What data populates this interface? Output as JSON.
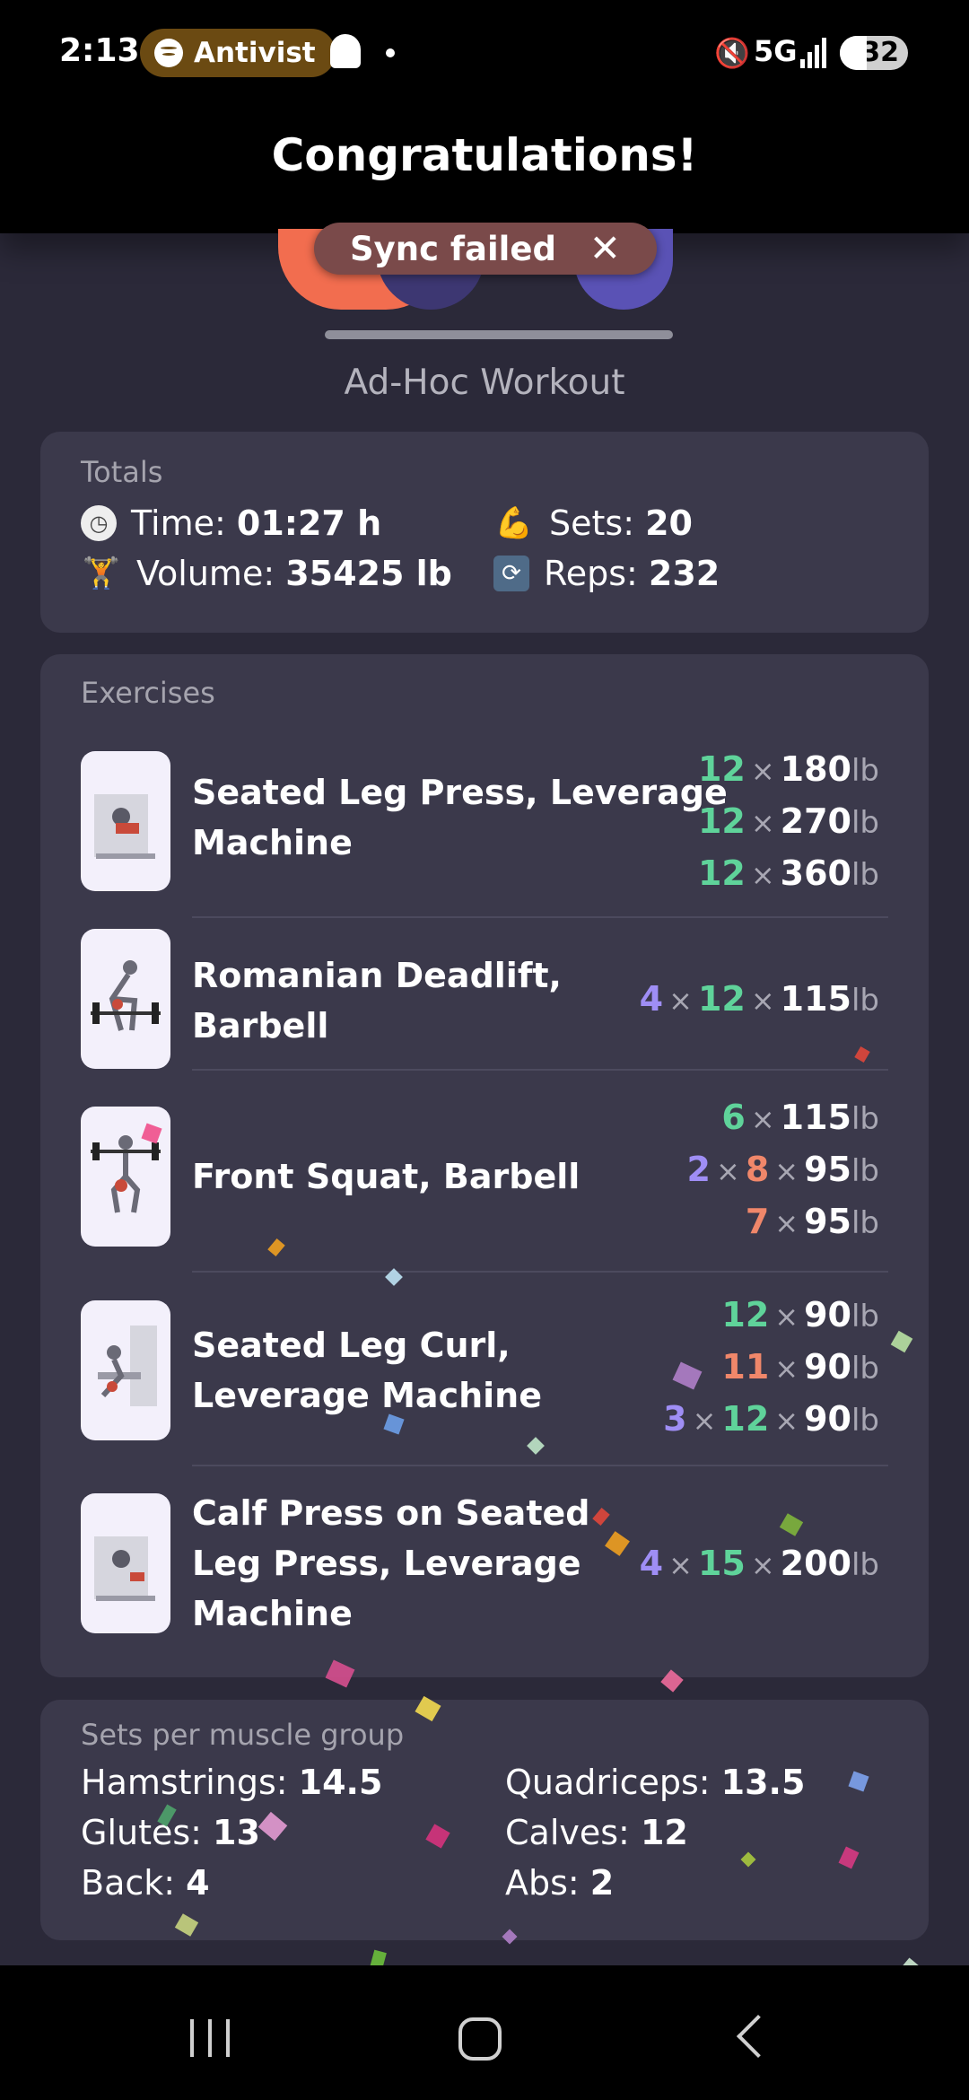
{
  "status_bar": {
    "time": "2:13",
    "media_app": "Antivist",
    "network": "5G",
    "battery": "32"
  },
  "header": {
    "title": "Congratulations!"
  },
  "toast": {
    "text": "Sync failed"
  },
  "workout": {
    "name": "Ad-Hoc Workout"
  },
  "totals": {
    "title": "Totals",
    "time_label": "Time: ",
    "time_value": "01:27 h",
    "sets_label": "Sets: ",
    "sets_value": "20",
    "volume_label": "Volume: ",
    "volume_value": "35425 lb",
    "reps_label": "Reps: ",
    "reps_value": "232"
  },
  "exercises": {
    "title": "Exercises",
    "unit": "lb",
    "sign": "×",
    "items": [
      {
        "name_line1": "Seated Leg Press, Leverage",
        "name_line2": "Machine",
        "sets": [
          {
            "reps": "12",
            "weight": "180"
          },
          {
            "reps": "12",
            "weight": "270"
          },
          {
            "reps": "12",
            "weight": "360"
          }
        ]
      },
      {
        "name_line1": "Romanian Deadlift,",
        "name_line2": "Barbell",
        "sets": [
          {
            "count": "4",
            "reps": "12",
            "weight": "115"
          }
        ]
      },
      {
        "name_line1": "Front Squat, Barbell",
        "sets": [
          {
            "reps": "6",
            "weight": "115"
          },
          {
            "count": "2",
            "reps": "8",
            "weight": "95"
          },
          {
            "reps": "7",
            "weight": "95"
          }
        ]
      },
      {
        "name_line1": "Seated Leg Curl,",
        "name_line2": "Leverage Machine",
        "sets": [
          {
            "reps": "12",
            "weight": "90"
          },
          {
            "reps": "11",
            "weight": "90"
          },
          {
            "count": "3",
            "reps": "12",
            "weight": "90"
          }
        ]
      },
      {
        "name_line1": "Calf Press on Seated",
        "name_line2": "Leg Press, Leverage",
        "name_line3": "Machine",
        "sets": [
          {
            "count": "4",
            "reps": "15",
            "weight": "200"
          }
        ]
      }
    ]
  },
  "muscle_groups": {
    "title": "Sets per muscle group",
    "items": [
      {
        "label": "Hamstrings: ",
        "value": "14.5"
      },
      {
        "label": "Quadriceps: ",
        "value": "13.5"
      },
      {
        "label": "Glutes: ",
        "value": "13"
      },
      {
        "label": "Calves: ",
        "value": "12"
      },
      {
        "label": "Back: ",
        "value": "4"
      },
      {
        "label": "Abs: ",
        "value": "2"
      }
    ]
  },
  "colors": {
    "background": "#2b2939",
    "card": "#3b394b",
    "green": "#5fd39a",
    "purple": "#9f8ef5",
    "orange": "#f0876a",
    "toast": "#7a4a4a"
  }
}
